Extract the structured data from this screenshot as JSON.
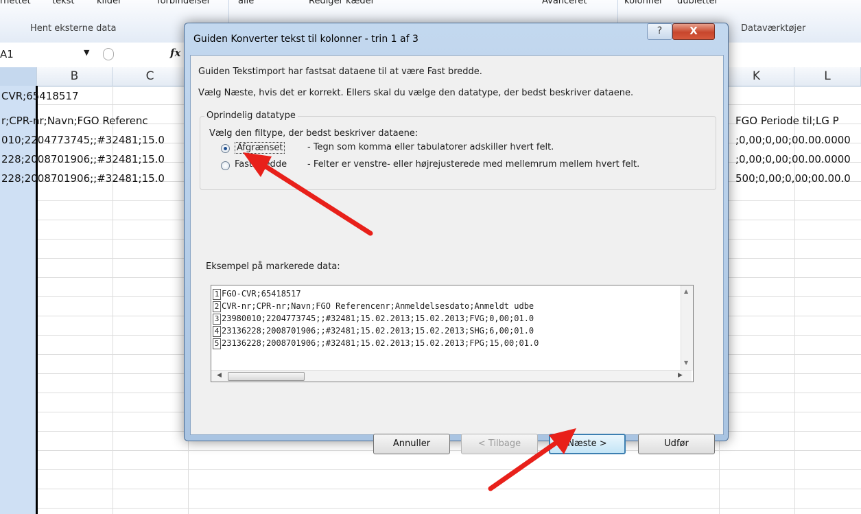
{
  "ribbon": {
    "top_labels": [
      "rnettet",
      "tekst",
      "kilder",
      "forbindelser",
      "alle",
      "Rediger kæder",
      "Avanceret",
      "kolonner",
      "dubletter"
    ],
    "group_labels": [
      "Hent eksterne data",
      "Dataværktøjer"
    ]
  },
  "formula_bar": {
    "name_box": "A1",
    "fx_label": "fx"
  },
  "columns": {
    "b": "B",
    "c": "C",
    "k": "K",
    "l": "L"
  },
  "cells": {
    "row1": "CVR;65418517",
    "row2": "r;CPR-nr;Navn;FGO Referenc",
    "row3": "010;2204773745;;#32481;15.0",
    "row4": "228;2008701906;;#32481;15.0",
    "row5": "228;2008701906;;#32481;15.0"
  },
  "cells_right": {
    "row2": "FGO Periode til;LG P",
    "row3": ";0,00;0,00;00.00.0000",
    "row4": ";0,00;0,00;00.00.0000",
    "row5": "500;0,00;0,00;00.00.0"
  },
  "dialog": {
    "title": "Guiden Konverter tekst til kolonner - trin 1 af 3",
    "help_label": "?",
    "close_label": "X",
    "intro1": "Guiden Tekstimport har fastsat dataene til at være Fast bredde.",
    "intro2": "Vælg Næste, hvis det er korrekt. Ellers skal du vælge den datatype, der bedst beskriver dataene.",
    "group_title": "Oprindelig datatype",
    "group_prompt": "Vælg den filtype, der bedst beskriver dataene:",
    "option1_label": "Afgrænset",
    "option1_desc": "- Tegn som komma eller tabulatorer adskiller hvert felt.",
    "option2_label": "Fast bredde",
    "option2_desc": "- Felter er venstre- eller højrejusterede med mellemrum mellem hvert felt.",
    "preview_title": "Eksempel på markerede data:",
    "preview_lines": [
      {
        "n": "1",
        "text": "FGO-CVR;65418517"
      },
      {
        "n": "2",
        "text": "CVR-nr;CPR-nr;Navn;FGO Referencenr;Anmeldelsesdato;Anmeldt udbe"
      },
      {
        "n": "3",
        "text": "23980010;2204773745;;#32481;15.02.2013;15.02.2013;FVG;0,00;01.0"
      },
      {
        "n": "4",
        "text": "23136228;2008701906;;#32481;15.02.2013;15.02.2013;SHG;6,00;01.0"
      },
      {
        "n": "5",
        "text": "23136228;2008701906;;#32481;15.02.2013;15.02.2013;FPG;15,00;01.0"
      }
    ],
    "buttons": {
      "cancel": "Annuller",
      "back": "< Tilbage",
      "next": "Næste >",
      "finish": "Udfør"
    }
  },
  "colors": {
    "arrow": "#e8201a",
    "selection": "#cfe0f4",
    "dialog_frame": "#b8cfe9"
  }
}
